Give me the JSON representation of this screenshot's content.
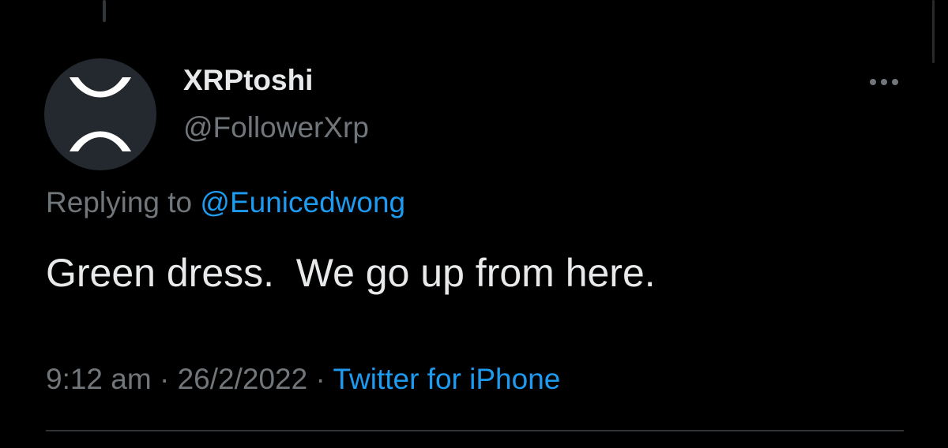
{
  "tweet": {
    "author": {
      "display_name": "XRPtoshi",
      "handle": "@FollowerXrp",
      "avatar_icon": "xrp-logo-icon"
    },
    "replying_label": "Replying to",
    "replying_to": "@Eunicedwong",
    "text": "Green dress.  We go up from here.",
    "time": "9:12 am",
    "separator": "·",
    "date": "26/2/2022",
    "source": "Twitter for iPhone",
    "more_icon": "more-horizontal-icon"
  },
  "colors": {
    "background": "#000000",
    "primary_text": "#e7e9ea",
    "secondary_text": "#71767b",
    "accent": "#1d9bf0",
    "divider": "#2f3336"
  }
}
